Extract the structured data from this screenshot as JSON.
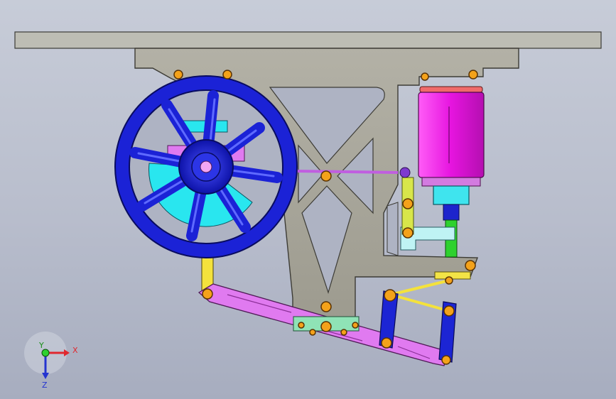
{
  "window": {
    "title": ""
  },
  "viewport": {
    "background_top": "#c7ccd8",
    "background_bottom": "#a7adbf",
    "part_colors": {
      "frame": "#a8a69a",
      "top_plate": "#b9b9b0",
      "flywheel": "#1b22d6",
      "hub_cyan": "#27e6ef",
      "linkage_magenta": "#e07af0",
      "cylinder_magenta": "#ee22e6",
      "yellow_rod": "#f7e63a",
      "green_rod": "#2ed12e",
      "pin_orange": "#f4a21a"
    }
  },
  "triad": {
    "x_label": "X",
    "y_label": "Y",
    "z_label": "Z"
  }
}
